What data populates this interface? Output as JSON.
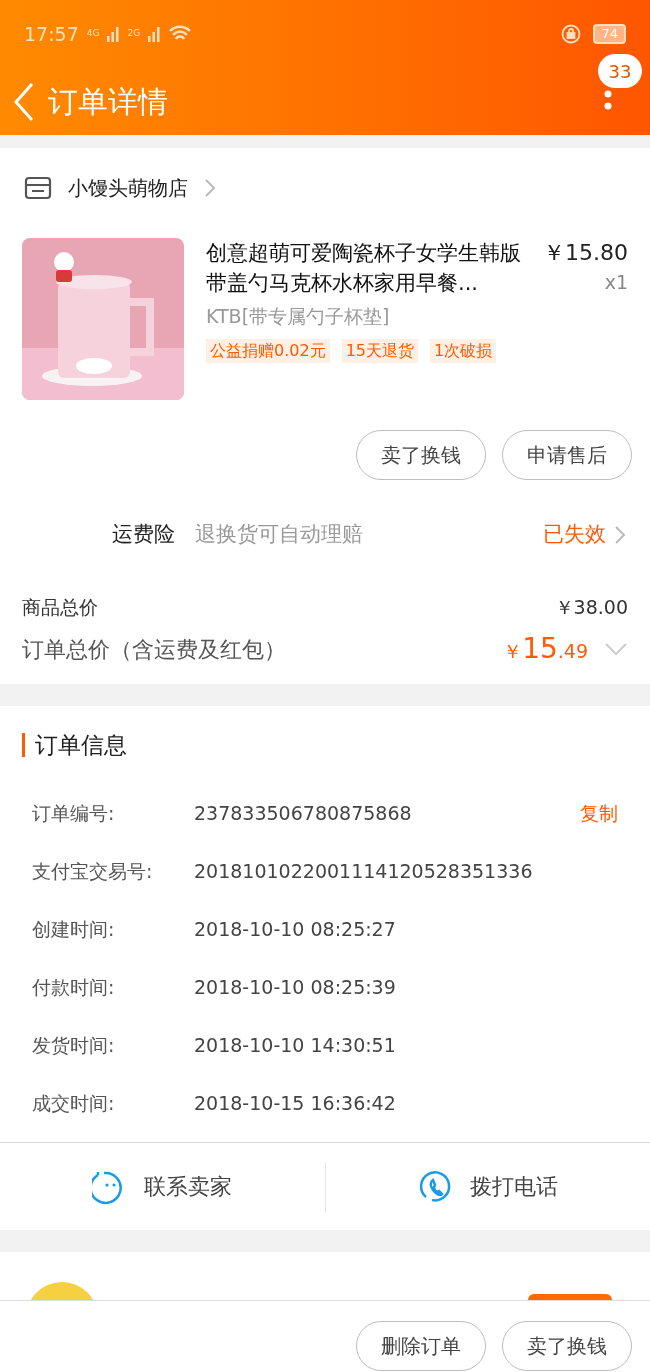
{
  "status_bar": {
    "time": "17:57",
    "network_1": "4G",
    "network_2": "2G",
    "battery": "74"
  },
  "header": {
    "title": "订单详情",
    "badge": "33"
  },
  "shop": {
    "name": "小馒头萌物店"
  },
  "product": {
    "kind": "picture",
    "title": "创意超萌可爱陶瓷杯子女学生韩版带盖勺马克杯水杯家用早餐...",
    "price": "￥15.80",
    "quantity": "x1",
    "variant": "KTB[带专属勺子杯垫]",
    "tags": [
      "公益捐赠0.02元",
      "15天退货",
      "1次破损"
    ]
  },
  "item_actions": [
    "卖了换钱",
    "申请售后"
  ],
  "insurance": {
    "label": "运费险",
    "description": "退换货可自动理赔",
    "status": "已失效"
  },
  "totals": {
    "goods_label": "商品总价",
    "goods_value": "￥38.00",
    "order_label": "订单总价（含运费及红包）",
    "currency": "￥",
    "order_int": "15",
    "order_dec": ".49"
  },
  "order_info": {
    "title": "订单信息",
    "copy": "复制",
    "rows": [
      {
        "label": "订单编号:",
        "value": "237833506780875868"
      },
      {
        "label": "支付宝交易号:",
        "value": "2018101022001114120528351336"
      },
      {
        "label": "创建时间:",
        "value": "2018-10-10 08:25:27"
      },
      {
        "label": "付款时间:",
        "value": "2018-10-10 08:25:39"
      },
      {
        "label": "发货时间:",
        "value": "2018-10-10 14:30:51"
      },
      {
        "label": "成交时间:",
        "value": "2018-10-15 16:36:42"
      }
    ]
  },
  "contact": [
    {
      "kind": "chat",
      "label": "联系卖家"
    },
    {
      "kind": "phone",
      "label": "拨打电话"
    }
  ],
  "bottom_actions": [
    "删除订单",
    "卖了换钱"
  ]
}
